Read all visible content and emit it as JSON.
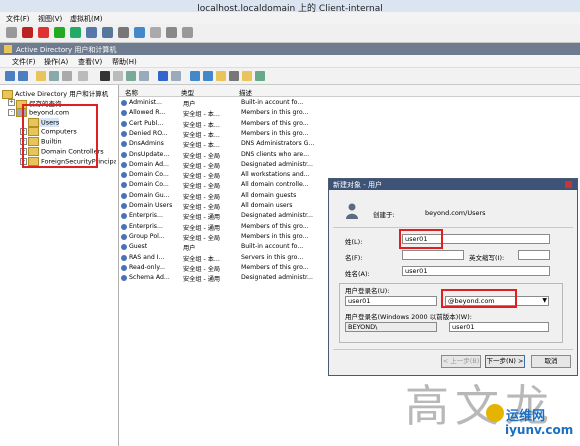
{
  "vm_window": {
    "title": "localhost.localdomain 上的 Client-internal",
    "menu": [
      "文件(F)",
      "视图(V)",
      "虚拟机(M)"
    ]
  },
  "mmc": {
    "title": "Active Directory 用户和计算机",
    "menu": [
      "文件(F)",
      "操作(A)",
      "查看(V)",
      "帮助(H)"
    ],
    "tree": {
      "root": "Active Directory 用户和计算机",
      "saved": "保存的查询",
      "domain": "beyond.com",
      "children": [
        "Users",
        "Computers",
        "Builtin",
        "Domain Controllers",
        "ForeignSecurityPrincipals"
      ]
    },
    "list": {
      "columns": [
        "名称",
        "类型",
        "描述"
      ],
      "rows": [
        [
          "Administ...",
          "用户",
          "Built-in account fo..."
        ],
        [
          "Allowed R...",
          "安全组 - 本...",
          "Members in this gro..."
        ],
        [
          "Cert Publ...",
          "安全组 - 本...",
          "Members of this gro..."
        ],
        [
          "Denied RO...",
          "安全组 - 本...",
          "Members in this gro..."
        ],
        [
          "DnsAdmins",
          "安全组 - 本...",
          "DNS Administrators G..."
        ],
        [
          "DnsUpdate...",
          "安全组 - 全局",
          "DNS clients who are..."
        ],
        [
          "Domain Ad...",
          "安全组 - 全局",
          "Designated administr..."
        ],
        [
          "Domain Co...",
          "安全组 - 全局",
          "All workstations and..."
        ],
        [
          "Domain Co...",
          "安全组 - 全局",
          "All domain controlle..."
        ],
        [
          "Domain Gu...",
          "安全组 - 全局",
          "All domain guests"
        ],
        [
          "Domain Users",
          "安全组 - 全局",
          "All domain users"
        ],
        [
          "Enterpris...",
          "安全组 - 通用",
          "Designated administr..."
        ],
        [
          "Enterpris...",
          "安全组 - 通用",
          "Members of this gro..."
        ],
        [
          "Group Pol...",
          "安全组 - 全局",
          "Members in this gro..."
        ],
        [
          "Guest",
          "用户",
          "Built-in account fo..."
        ],
        [
          "RAS and I...",
          "安全组 - 本...",
          "Servers in this gro..."
        ],
        [
          "Read-only...",
          "安全组 - 全局",
          "Members of this gro..."
        ],
        [
          "Schema Ad...",
          "安全组 - 通用",
          "Designated administr..."
        ]
      ]
    }
  },
  "dialog": {
    "title": "新建对象 - 用户",
    "create_in_label": "创建于:",
    "create_in_value": "beyond.com/Users",
    "last_name_label": "姓(L):",
    "last_name_value": "user01",
    "first_name_label": "名(F):",
    "first_name_value": "",
    "initials_label": "英文缩写(I):",
    "initials_value": "",
    "full_name_label": "姓名(A):",
    "full_name_value": "user01",
    "logon_name_label": "用户登录名(U):",
    "logon_name_value": "user01",
    "domain_suffix": "@beyond.com",
    "pre2000_label": "用户登录名(Windows 2000 以前版本)(W):",
    "pre2000_domain": "BEYOND\\",
    "pre2000_value": "user01",
    "back_button": "< 上一步(B)",
    "next_button": "下一步(N) >",
    "cancel_button": "取消"
  },
  "watermark": {
    "text": "高文龙",
    "site_name": "运维网",
    "site_url": "iyunv.com"
  },
  "colors": {
    "highlight_red": "#e02020",
    "dialog_title": "#3d5478",
    "mmc_title": "#6f7c8f"
  }
}
